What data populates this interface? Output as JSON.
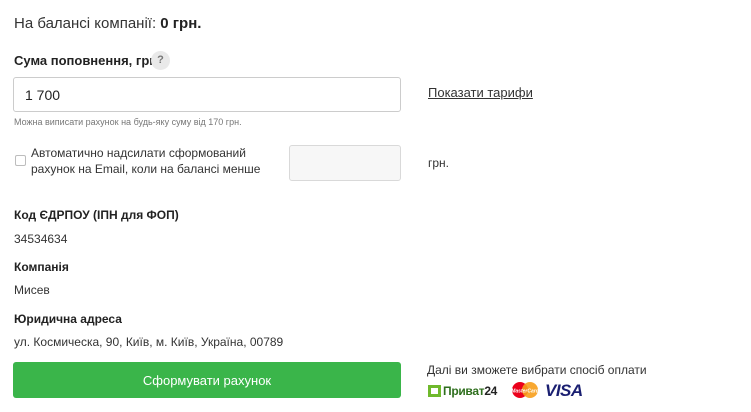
{
  "balance": {
    "label": "На балансі компанії:",
    "value": "0 грн."
  },
  "amount": {
    "label": "Сума поповнення, грн",
    "help_icon": "?",
    "value": "1 700",
    "hint": "Можна виписати рахунок на будь-яку суму від 170 грн."
  },
  "tariffs_link": "Показати тарифи",
  "auto_send": {
    "checked": false,
    "label": "Автоматично надсилати сформований рахунок на Email, коли на балансі менше",
    "threshold_value": "",
    "currency": "грн."
  },
  "fields": {
    "edrpou_label": "Код ЄДРПОУ (ІПН для ФОП)",
    "edrpou_value": "34534634",
    "company_label": "Компанія",
    "company_value": "Мисев",
    "address_label": "Юридична адреса",
    "address_value": "ул. Космическа, 90, Київ, м. Київ, Україна, 00789"
  },
  "submit_button": "Сформувати рахунок",
  "payment": {
    "note": "Далі ви зможете вибрати спосіб оплати",
    "privat_name": "Приват",
    "privat_num": "24",
    "mastercard_text": "MasterCard",
    "visa_text": "VISA"
  },
  "colors": {
    "button_green": "#3ab54a",
    "privat_green": "#6fb92c",
    "visa_blue": "#1a1f71",
    "mastercard_red": "#eb001b",
    "mastercard_orange": "#f79e1b"
  }
}
